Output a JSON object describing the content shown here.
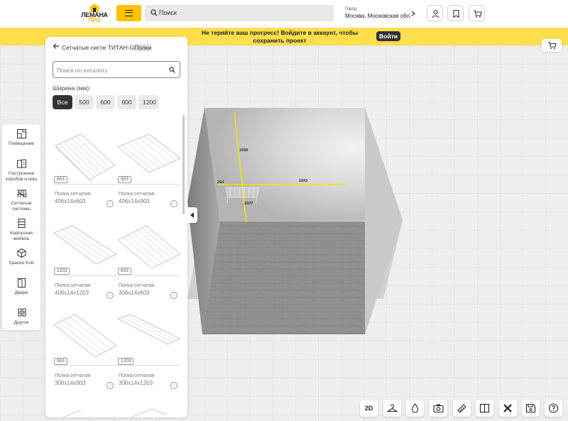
{
  "header": {
    "logo_line1": "ЛЕМАНА",
    "logo_line2": "ПРО",
    "search_placeholder": "Поиск",
    "city_label": "Город",
    "city_value": "Москва, Московская обл."
  },
  "banner": {
    "text": "Не теряйте ваш прогресс! Войдите в аккаунт, чтобы сохранить проект",
    "button": "Войти"
  },
  "toolbar": {
    "items": [
      {
        "label": "Помещение",
        "icon": "room-plan-icon"
      },
      {
        "label": "Построение коробов и ниш",
        "icon": "boxes-icon"
      },
      {
        "label": "Сетчатые системы",
        "icon": "mesh-shelf-icon"
      },
      {
        "label": "Корпусная мебель",
        "icon": "cabinet-icon"
      },
      {
        "label": "Spaceo Kub",
        "icon": "cube-icon"
      },
      {
        "label": "Двери",
        "icon": "door-icon"
      },
      {
        "label": "Другое",
        "icon": "grid-icon"
      }
    ]
  },
  "panel": {
    "title_prefix": "Сетчатые систе ТИТАН-G",
    "title_highlight": "Полки",
    "search_placeholder": "Поиск по каталогу",
    "width_label": "Ширина (мм):",
    "chips": [
      "Все",
      "500",
      "600",
      "900",
      "1200"
    ],
    "products": [
      {
        "tag": "603",
        "name": "Полка сетчатая",
        "size": "406x14x603"
      },
      {
        "tag": "903",
        "name": "Полка сетчатая",
        "size": "406x14x903"
      },
      {
        "tag": "1203",
        "name": "Полка сетчатая",
        "size": "406x14x1203"
      },
      {
        "tag": "603",
        "name": "Полка сетчатая",
        "size": "306x14x603"
      },
      {
        "tag": "903",
        "name": "Полка сетчатая",
        "size": "306x14x903"
      },
      {
        "tag": "1203",
        "name": "Полка сетчатая",
        "size": "306x14x1203"
      }
    ]
  },
  "scene": {
    "dimensions": {
      "height": "1658",
      "left_offset": "254",
      "right_length": "1943",
      "shelf_height": "1037"
    }
  },
  "bottom_tools": {
    "view_2d": "2D",
    "items": [
      "hanger-icon",
      "light-icon",
      "camera-icon",
      "measure-icon",
      "split-view-icon",
      "tools-icon",
      "save-icon",
      "help-icon"
    ]
  },
  "colors": {
    "brand_yellow": "#fdc300",
    "banner_yellow": "#fdde4d",
    "dimension_yellow": "#f2e600"
  }
}
